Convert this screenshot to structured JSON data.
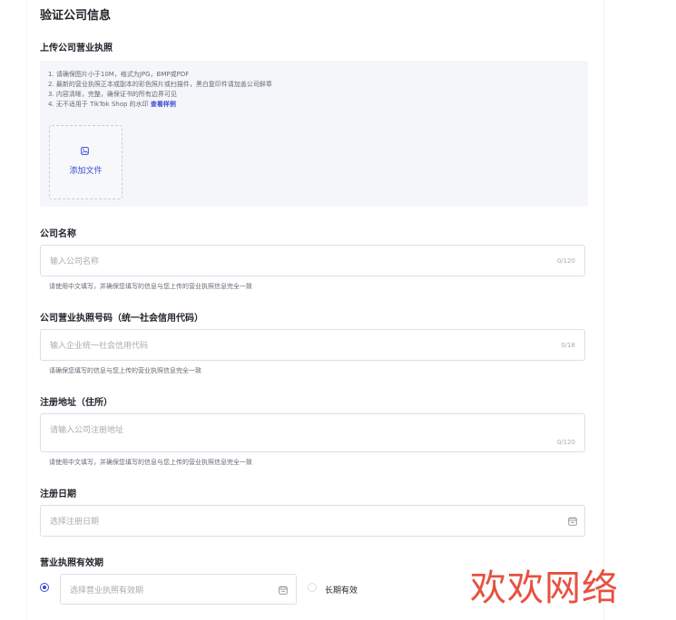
{
  "page_title": "验证公司信息",
  "upload": {
    "label": "上传公司营业执照",
    "requirements": [
      "1. 请确保图片小于10M，格式为JPG，BMP或PDF",
      "2. 最新的营业执照正本或副本的彩色照片或扫描件，黑白复印件请加盖公司鲜章",
      "3. 内容清晰，完整，确保证书的所有边界可见",
      "4. 无不适用于 TikTok Shop 的水印"
    ],
    "sample_link": "查看样例",
    "add_file_label": "添加文件",
    "file_icon": "image-file-icon"
  },
  "company_name": {
    "label": "公司名称",
    "placeholder": "输入公司名称",
    "counter": "0/120",
    "hint": "请使用中文填写，并确保您填写的信息与您上传的营业执照信息完全一致"
  },
  "license_number": {
    "label": "公司营业执照号码（统一社会信用代码）",
    "placeholder": "输入企业统一社会信用代码",
    "counter": "0/18",
    "hint": "请确保您填写的信息与您上传的营业执照信息完全一致"
  },
  "address": {
    "label": "注册地址（住所）",
    "placeholder": "请输入公司注册地址",
    "counter": "0/120",
    "hint": "请使用中文填写，并确保您填写的信息与您上传的营业执照信息完全一致"
  },
  "reg_date": {
    "label": "注册日期",
    "placeholder": "选择注册日期",
    "icon": "calendar-icon"
  },
  "validity": {
    "label": "营业执照有效期",
    "placeholder": "选择营业执照有效期",
    "long_term_label": "长期有效",
    "selected": "date-range"
  },
  "watermark": "欢欢网络",
  "colors": {
    "accent": "#3b4bd8",
    "watermark": "#e8513f"
  }
}
